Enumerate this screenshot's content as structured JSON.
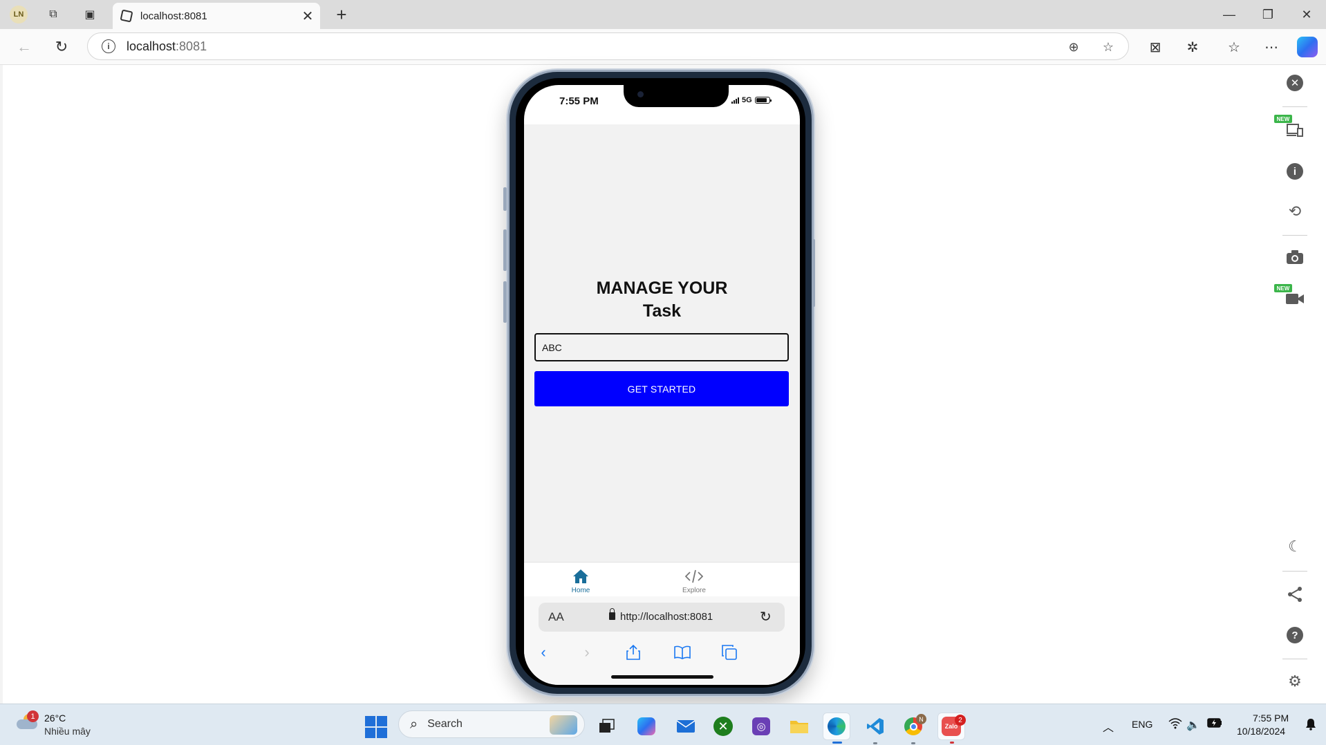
{
  "browser": {
    "profile_initials": "LN",
    "tab_title": "localhost:8081",
    "url_host": "localhost",
    "url_port": ":8081"
  },
  "device": {
    "status_time": "7:55 PM",
    "network": "5G",
    "app": {
      "title_line1": "MANAGE YOUR",
      "title_line2": "Task",
      "input_value": "ABC",
      "button_label": "GET STARTED",
      "button_color": "#0000ff"
    },
    "tabs": [
      {
        "label": "Home",
        "icon": "home-icon",
        "active": true
      },
      {
        "label": "Explore",
        "icon": "code-icon",
        "active": false
      }
    ],
    "safari": {
      "text_size_label": "AA",
      "url": "http://localhost:8081"
    }
  },
  "devtools": {
    "new_badge": "NEW"
  },
  "taskbar": {
    "weather_badge": "1",
    "temperature": "26°C",
    "weather_desc": "Nhiều mây",
    "search_label": "Search",
    "copilot_badge": "N",
    "zalo_badge": "2",
    "language": "ENG",
    "time": "7:55 PM",
    "date": "10/18/2024"
  }
}
